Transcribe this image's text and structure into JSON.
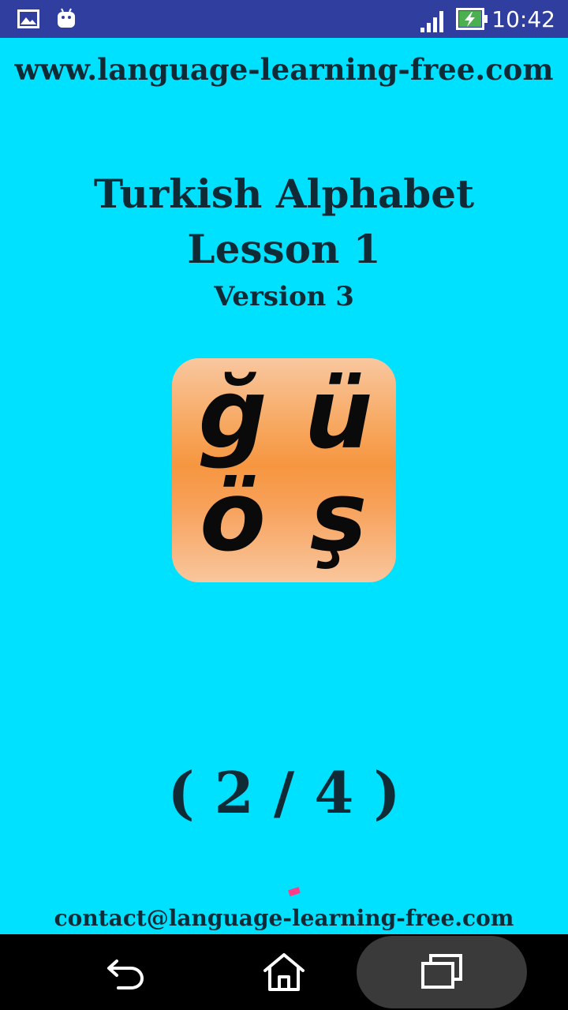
{
  "status_bar": {
    "time": "10:42",
    "icons": {
      "left": [
        "image-icon",
        "android-icon"
      ],
      "right": [
        "signal-icon",
        "battery-charging-icon"
      ]
    }
  },
  "main": {
    "website": "www.language-learning-free.com",
    "title": "Turkish Alphabet",
    "lesson": "Lesson 1",
    "version": "Version 3",
    "letters": [
      "ğ",
      "ü",
      "ö",
      "ş"
    ],
    "page_indicator": "( 2 / 4 )",
    "contact": "contact@language-learning-free.com"
  },
  "nav_bar": {
    "buttons": [
      "back-icon",
      "home-icon",
      "recents-icon"
    ]
  },
  "colors": {
    "background": "#00e0ff",
    "status_bar": "#303f9f",
    "text": "#102a36",
    "tile_center": "#f69640",
    "tile_edge": "#f9c79f"
  }
}
